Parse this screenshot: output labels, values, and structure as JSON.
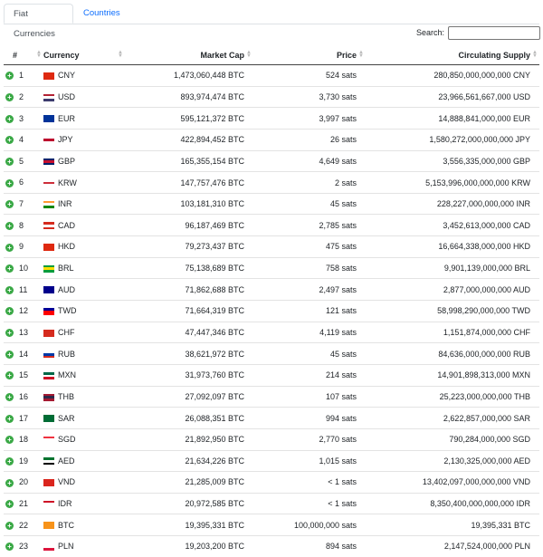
{
  "tabs": [
    {
      "label": "Fiat Currencies",
      "active": true
    },
    {
      "label": "Countries",
      "active": false
    }
  ],
  "search": {
    "label": "Search:",
    "value": ""
  },
  "table": {
    "headers": [
      "#",
      "Currency",
      "Market Cap",
      "Price",
      "Circulating Supply"
    ],
    "rows": [
      {
        "rank": "1",
        "code": "CNY",
        "market_cap": "1,473,060,448 BTC",
        "price": "524 sats",
        "supply": "280,850,000,000,000 CNY",
        "flag": [
          "#de2910",
          "#de2910",
          "#de2910"
        ]
      },
      {
        "rank": "2",
        "code": "USD",
        "market_cap": "893,974,474 BTC",
        "price": "3,730 sats",
        "supply": "23,966,561,667,000 USD",
        "flag": [
          "#b22234",
          "#ffffff",
          "#3c3b6e"
        ]
      },
      {
        "rank": "3",
        "code": "EUR",
        "market_cap": "595,121,372 BTC",
        "price": "3,997 sats",
        "supply": "14,888,841,000,000 EUR",
        "flag": [
          "#003399",
          "#003399",
          "#003399"
        ]
      },
      {
        "rank": "4",
        "code": "JPY",
        "market_cap": "422,894,452 BTC",
        "price": "26 sats",
        "supply": "1,580,272,000,000,000 JPY",
        "flag": [
          "#ffffff",
          "#bc002d",
          "#ffffff"
        ]
      },
      {
        "rank": "5",
        "code": "GBP",
        "market_cap": "165,355,154 BTC",
        "price": "4,649 sats",
        "supply": "3,556,335,000,000 GBP",
        "flag": [
          "#012169",
          "#c8102e",
          "#012169"
        ]
      },
      {
        "rank": "6",
        "code": "KRW",
        "market_cap": "147,757,476 BTC",
        "price": "2 sats",
        "supply": "5,153,996,000,000,000 KRW",
        "flag": [
          "#ffffff",
          "#cd2e3a",
          "#ffffff"
        ]
      },
      {
        "rank": "7",
        "code": "INR",
        "market_cap": "103,181,310 BTC",
        "price": "45 sats",
        "supply": "228,227,000,000,000 INR",
        "flag": [
          "#ff9933",
          "#ffffff",
          "#138808"
        ]
      },
      {
        "rank": "8",
        "code": "CAD",
        "market_cap": "96,187,469 BTC",
        "price": "2,785 sats",
        "supply": "3,452,613,000,000 CAD",
        "flag": [
          "#d52b1e",
          "#ffffff",
          "#d52b1e"
        ]
      },
      {
        "rank": "9",
        "code": "HKD",
        "market_cap": "79,273,437 BTC",
        "price": "475 sats",
        "supply": "16,664,338,000,000 HKD",
        "flag": [
          "#de2910",
          "#de2910",
          "#de2910"
        ]
      },
      {
        "rank": "10",
        "code": "BRL",
        "market_cap": "75,138,689 BTC",
        "price": "758 sats",
        "supply": "9,901,139,000,000 BRL",
        "flag": [
          "#009c3b",
          "#ffdf00",
          "#009c3b"
        ]
      },
      {
        "rank": "11",
        "code": "AUD",
        "market_cap": "71,862,688 BTC",
        "price": "2,497 sats",
        "supply": "2,877,000,000,000 AUD",
        "flag": [
          "#00008b",
          "#00008b",
          "#00008b"
        ]
      },
      {
        "rank": "12",
        "code": "TWD",
        "market_cap": "71,664,319 BTC",
        "price": "121 sats",
        "supply": "58,998,290,000,000 TWD",
        "flag": [
          "#000095",
          "#fe0000",
          "#fe0000"
        ]
      },
      {
        "rank": "13",
        "code": "CHF",
        "market_cap": "47,447,346 BTC",
        "price": "4,119 sats",
        "supply": "1,151,874,000,000 CHF",
        "flag": [
          "#d52b1e",
          "#d52b1e",
          "#d52b1e"
        ]
      },
      {
        "rank": "14",
        "code": "RUB",
        "market_cap": "38,621,972 BTC",
        "price": "45 sats",
        "supply": "84,636,000,000,000 RUB",
        "flag": [
          "#ffffff",
          "#0039a6",
          "#d52b1e"
        ]
      },
      {
        "rank": "15",
        "code": "MXN",
        "market_cap": "31,973,760 BTC",
        "price": "214 sats",
        "supply": "14,901,898,313,000 MXN",
        "flag": [
          "#006847",
          "#ffffff",
          "#ce1126"
        ]
      },
      {
        "rank": "16",
        "code": "THB",
        "market_cap": "27,092,097 BTC",
        "price": "107 sats",
        "supply": "25,223,000,000,000 THB",
        "flag": [
          "#a51931",
          "#2d2a4a",
          "#a51931"
        ]
      },
      {
        "rank": "17",
        "code": "SAR",
        "market_cap": "26,088,351 BTC",
        "price": "994 sats",
        "supply": "2,622,857,000,000 SAR",
        "flag": [
          "#006c35",
          "#006c35",
          "#006c35"
        ]
      },
      {
        "rank": "18",
        "code": "SGD",
        "market_cap": "21,892,950 BTC",
        "price": "2,770 sats",
        "supply": "790,284,000,000 SGD",
        "flag": [
          "#ef3340",
          "#ffffff",
          "#ffffff"
        ]
      },
      {
        "rank": "19",
        "code": "AED",
        "market_cap": "21,634,226 BTC",
        "price": "1,015 sats",
        "supply": "2,130,325,000,000 AED",
        "flag": [
          "#00732f",
          "#ffffff",
          "#000000"
        ]
      },
      {
        "rank": "20",
        "code": "VND",
        "market_cap": "21,285,009 BTC",
        "price": "< 1 sats",
        "supply": "13,402,097,000,000,000 VND",
        "flag": [
          "#da251d",
          "#da251d",
          "#da251d"
        ]
      },
      {
        "rank": "21",
        "code": "IDR",
        "market_cap": "20,972,585 BTC",
        "price": "< 1 sats",
        "supply": "8,350,400,000,000,000 IDR",
        "flag": [
          "#ce1126",
          "#ffffff",
          "#ffffff"
        ]
      },
      {
        "rank": "22",
        "code": "BTC",
        "market_cap": "19,395,331 BTC",
        "price": "100,000,000 sats",
        "supply": "19,395,331 BTC",
        "flag": [
          "#f7931a",
          "#f7931a",
          "#f7931a"
        ]
      },
      {
        "rank": "23",
        "code": "PLN",
        "market_cap": "19,203,200 BTC",
        "price": "894 sats",
        "supply": "2,147,524,000,000 PLN",
        "flag": [
          "#ffffff",
          "#ffffff",
          "#dc143c"
        ]
      }
    ]
  },
  "colors": {
    "accent": "#0d6efd",
    "expand": "#39a845"
  }
}
